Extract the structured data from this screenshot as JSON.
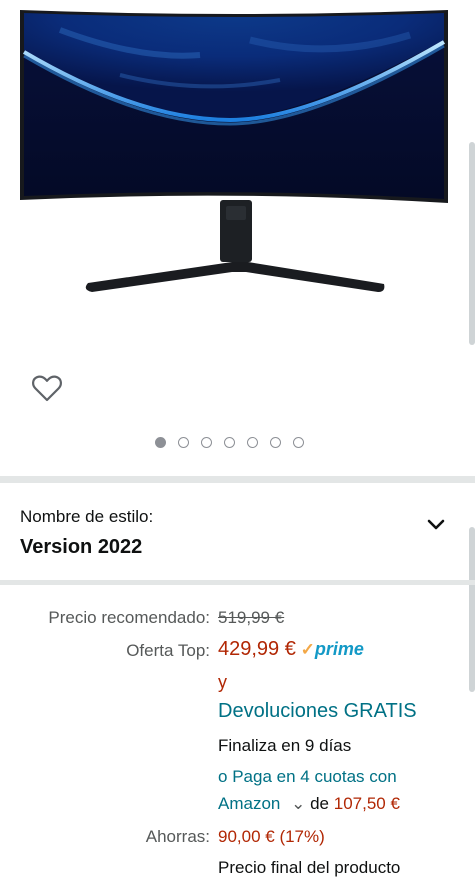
{
  "product": {
    "image_alt": "Monitor curvo",
    "carousel": {
      "count": 7,
      "active_index": 0
    }
  },
  "style_selector": {
    "label": "Nombre de estilo:",
    "value": "Version 2022"
  },
  "pricing": {
    "list_price_label": "Precio recomendado:",
    "list_price": "519,99 €",
    "deal_label": "Oferta Top:",
    "deal_price": "429,99 €",
    "prime_check": "✓",
    "prime_word": "prime",
    "and_word": "y",
    "returns_link": "Devoluciones GRATIS",
    "ends_text": "Finaliza en 9 días",
    "installments_prefix": "o",
    "installments_link_1": "Paga en 4 cuotas con",
    "installments_link_2": "Amazon",
    "installments_chevron": "⌄",
    "installments_de": "de",
    "installments_amount": "107,50 €",
    "savings_label": "Ahorras:",
    "savings_value": "90,00 € (17%)",
    "final_price_text": "Precio final del producto"
  },
  "colors": {
    "price_red": "#b12704",
    "link_teal": "#007185",
    "prime_blue": "#1399c6",
    "prime_orange": "#f3a847",
    "label_grey": "#565959"
  },
  "icons": [
    "heart-icon",
    "chevron-down-icon",
    "prime-check-icon"
  ]
}
